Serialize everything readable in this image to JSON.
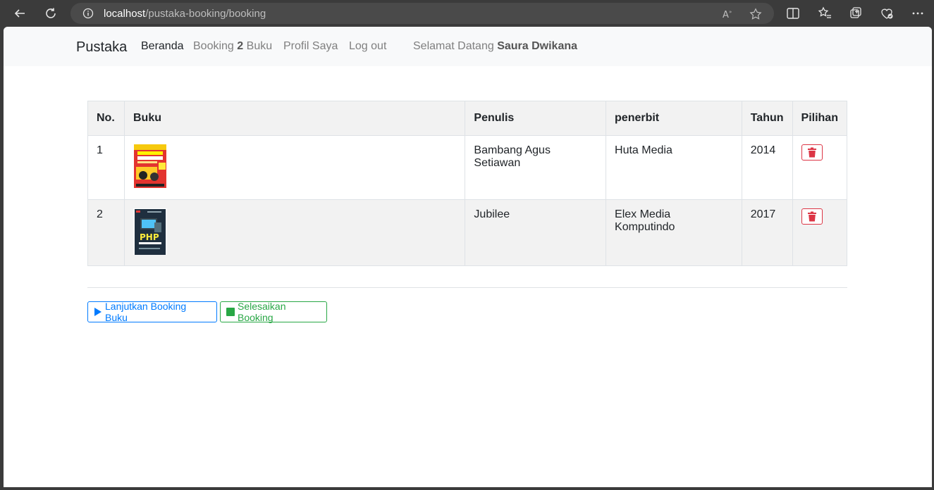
{
  "browser": {
    "url_host": "localhost",
    "url_path": "/pustaka-booking/booking"
  },
  "navbar": {
    "brand": "Pustaka",
    "home": "Beranda",
    "booking_prefix": "Booking",
    "booking_count": "2",
    "booking_suffix": "Buku",
    "profile": "Profil Saya",
    "logout": "Log out",
    "welcome_prefix": "Selamat Datang",
    "user_name": "Saura Dwikana"
  },
  "table": {
    "headers": {
      "no": "No.",
      "book": "Buku",
      "author": "Penulis",
      "publisher": "penerbit",
      "year": "Tahun",
      "options": "Pilihan"
    },
    "rows": [
      {
        "no": "1",
        "author": "Bambang Agus Setiawan",
        "publisher": "Huta Media",
        "year": "2014",
        "cover_icon": "book-cover-belajar-komputer"
      },
      {
        "no": "2",
        "author": "Jubilee",
        "publisher": "Elex Media Komputindo",
        "year": "2017",
        "cover_icon": "book-cover-php-komplet"
      }
    ]
  },
  "actions": {
    "continue_label": "Lanjutkan Booking Buku",
    "finish_label": "Selesaikan Booking"
  },
  "colors": {
    "primary": "#007bff",
    "success": "#28a745",
    "danger": "#dc3545"
  }
}
